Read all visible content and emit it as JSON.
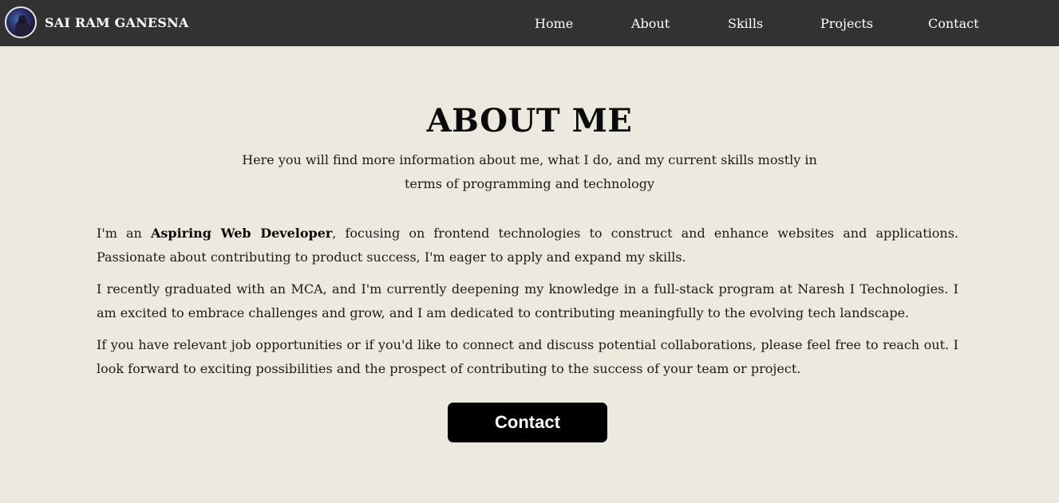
{
  "navbar": {
    "brand": "SAI RAM GANESNA",
    "links": [
      {
        "label": "Home"
      },
      {
        "label": "About"
      },
      {
        "label": "Skills"
      },
      {
        "label": "Projects"
      },
      {
        "label": "Contact"
      }
    ]
  },
  "about": {
    "title": "ABOUT ME",
    "subtitle": "Here you will find more information about me, what I do, and my current skills mostly in terms of programming and technology",
    "p1_pre": "I'm an ",
    "p1_bold": "Aspiring Web Developer",
    "p1_post": ", focusing on frontend technologies to construct and enhance websites and applications. Passionate about contributing to product success, I'm eager to apply and expand my skills.",
    "p2": "I recently graduated with an MCA, and I'm currently deepening my knowledge in a full-stack program at Naresh I Technologies. I am excited to embrace challenges and grow, and I am dedicated to contributing meaningfully to the evolving tech landscape.",
    "p3": "If you have relevant job opportunities or if you'd like to connect and discuss potential collaborations, please feel free to reach out. I look forward to exciting possibilities and the prospect of contributing to the success of your team or project.",
    "button_label": "Contact"
  },
  "colors": {
    "navbar_bg": "#323232",
    "page_bg": "#ece9df",
    "button_bg": "#000000",
    "text": "#111111"
  }
}
